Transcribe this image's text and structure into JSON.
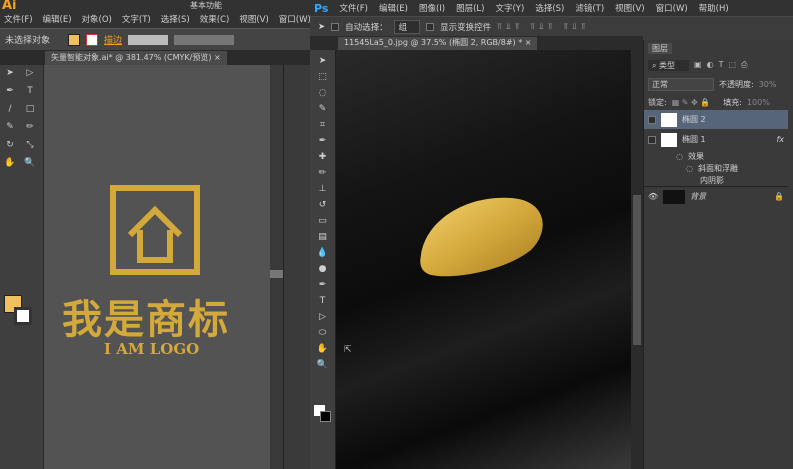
{
  "ai": {
    "logo": "Ai",
    "workspace": "基本功能",
    "menu": [
      "文件(F)",
      "编辑(E)",
      "对象(O)",
      "文字(T)",
      "选择(S)",
      "效果(C)",
      "视图(V)",
      "窗口(W)"
    ],
    "control": {
      "selection": "未选择对象",
      "stroke_label": "描边"
    },
    "tab": "矢量智能对象.ai* @ 381.47% (CMYK/预览)",
    "artwork": {
      "title": "我是商标",
      "subtitle": "I AM LOGO"
    },
    "gold": "#d4a93c"
  },
  "ps": {
    "logo": "Ps",
    "menu": [
      "文件(F)",
      "编辑(E)",
      "图像(I)",
      "图层(L)",
      "文字(Y)",
      "选择(S)",
      "滤镜(T)",
      "视图(V)",
      "窗口(W)",
      "帮助(H)"
    ],
    "options": {
      "auto_select": "自动选择：",
      "auto_select_value": "组",
      "show_transform": "显示变换控件"
    },
    "tab": "11545La5_0.jpg @ 37.5% (椭圆 2, RGB/8#) *",
    "layers": {
      "title": "图层",
      "filter": "类型",
      "blend": "正常",
      "opacity_label": "不透明度:",
      "opacity": "30%",
      "lock_label": "锁定:",
      "fill_label": "填充:",
      "fill": "100%",
      "items": [
        {
          "name": "椭圆 2",
          "selected": true
        },
        {
          "name": "椭圆 1",
          "fx": "fx"
        }
      ],
      "effects_label": "效果",
      "effects": [
        "斜面和浮雕",
        "内阴影"
      ],
      "background": "背景"
    }
  }
}
